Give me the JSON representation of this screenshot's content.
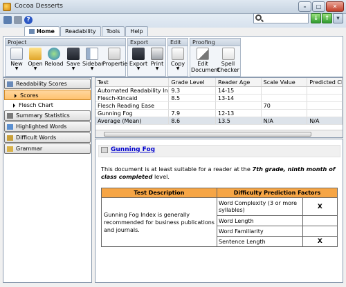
{
  "window": {
    "title": "Cocoa Desserts"
  },
  "tabs": [
    "Home",
    "Readability",
    "Tools",
    "Help"
  ],
  "ribbon": {
    "groups": [
      {
        "title": "Project",
        "buttons": [
          "New",
          "Open",
          "Reload",
          "Save",
          "Sidebar",
          "Properties"
        ]
      },
      {
        "title": "Export",
        "buttons": [
          "Export",
          "Print"
        ]
      },
      {
        "title": "Edit",
        "buttons": [
          "Copy"
        ]
      },
      {
        "title": "Proofing",
        "buttons": [
          "Edit Document",
          "Spell Checker"
        ]
      }
    ]
  },
  "sidebar": {
    "sections": [
      "Readability Scores",
      "Summary Statistics",
      "Highlighted Words",
      "Difficult Words",
      "Grammar"
    ],
    "subitems": [
      "Scores",
      "Flesch Chart"
    ]
  },
  "results": {
    "columns": [
      "Test",
      "Grade Level",
      "Reader Age",
      "Scale Value",
      "Predicted Cloze"
    ],
    "rows": [
      [
        "Automated Readability Index",
        "9.3",
        "14-15",
        "",
        ""
      ],
      [
        "Flesch-Kincaid",
        "8.5",
        "13-14",
        "",
        ""
      ],
      [
        "Flesch Reading Ease",
        "",
        "",
        "70",
        ""
      ],
      [
        "Gunning Fog",
        "7.9",
        "12-13",
        "",
        ""
      ],
      [
        "Average (Mean)",
        "8.6",
        "13.5",
        "N/A",
        "N/A"
      ]
    ]
  },
  "detail": {
    "title": "Gunning Fog",
    "text_before": "This document is at least suitable for a reader at the ",
    "text_bold": "7th grade, ninth month of class completed",
    "text_after": " level.",
    "table": {
      "header_desc": "Test Description",
      "header_factors": "Difficulty Prediction Factors",
      "description": "Gunning Fog Index is generally recommended for business publications and journals.",
      "factors": [
        {
          "name": "Word Complexity (3 or more syllables)",
          "mark": "X"
        },
        {
          "name": "Word Length",
          "mark": ""
        },
        {
          "name": "Word Familiarity",
          "mark": ""
        },
        {
          "name": "Sentence Length",
          "mark": "X"
        }
      ]
    }
  },
  "colors": {
    "selected": "#ffc26e",
    "table_header": "#f6a545",
    "link": "#0000cc"
  }
}
